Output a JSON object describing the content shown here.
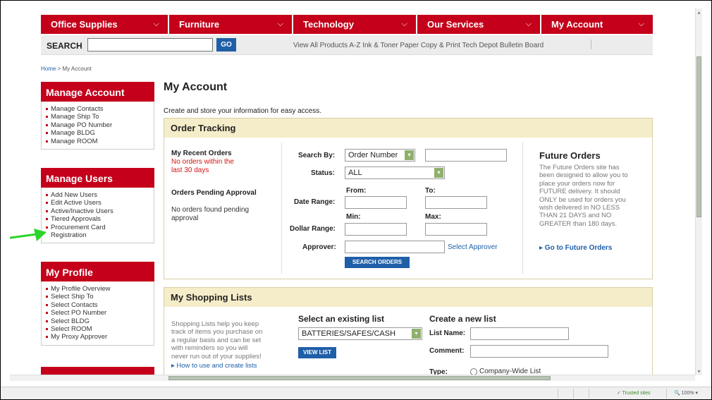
{
  "nav": {
    "items": [
      "Office Supplies",
      "Furniture",
      "Technology",
      "Our Services",
      "My Account"
    ],
    "chevron": "⌵"
  },
  "search": {
    "label": "SEARCH",
    "go": "GO",
    "quick_links": "View All Products A-Z Ink & Toner Paper Copy & Print Tech Depot Bulletin Board"
  },
  "breadcrumb": {
    "home": "Home",
    "sep": " > ",
    "current": "My Account"
  },
  "sidebar": {
    "manage_account": {
      "title": "Manage Account",
      "items": [
        "Manage Contacts",
        "Manage Ship To",
        "Manage PO Number",
        "Manage BLDG",
        "Manage ROOM"
      ]
    },
    "manage_users": {
      "title": "Manage Users",
      "items": [
        "Add New Users",
        "Edit Active Users",
        "Active/Inactive Users",
        "Tiered Approvals",
        "Procurement Card",
        "Registration"
      ]
    },
    "my_profile": {
      "title": "My Profile",
      "items": [
        "My Profile Overview",
        "Select Ship To",
        "Select Contacts",
        "Select PO Number",
        "Select BLDG",
        "Select ROOM",
        "My Proxy Approver"
      ]
    }
  },
  "main": {
    "title": "My Account",
    "intro": "Create and store your information for easy access.",
    "order_tracking": {
      "title": "Order Tracking",
      "recent_orders": "My Recent Orders",
      "recent_orders_note_1": "No orders within the",
      "recent_orders_note_2": "last 30 days",
      "pending": "Orders Pending Approval",
      "pending_note_1": "No orders found pending",
      "pending_note_2": "approval",
      "search_by": "Search By:",
      "search_by_value": "Order Number",
      "status": "Status:",
      "status_value": "ALL",
      "from": "From:",
      "to": "To:",
      "date_range": "Date Range:",
      "min": "Min:",
      "max": "Max:",
      "dollar_range": "Dollar Range:",
      "approver": "Approver:",
      "select_approver": "Select Approver",
      "search_orders": "SEARCH ORDERS"
    },
    "future_orders": {
      "title": "Future Orders",
      "lines": [
        "The Future Orders site has",
        "been designed to allow you to",
        "place your orders now for",
        "FUTURE delivery. It should",
        "ONLY be used for orders you",
        "wish delivered in NO LESS",
        "THAN 21 DAYS and NO",
        "GREATER than 180 days."
      ],
      "link": "▸ Go to Future Orders"
    },
    "shopping_lists": {
      "title": "My Shopping Lists",
      "desc_lines": [
        "Shopping Lists help you keep",
        "track of items you purchase on",
        "a regular basis and can be set",
        "with reminders so you will",
        "never run out of your supplies!"
      ],
      "how_to": "▸ How to use and create lists",
      "select_existing": "Select an existing list",
      "existing_value": "BATTERIES/SAFES/CASH",
      "view_list": "VIEW LIST",
      "create_new": "Create a new list",
      "list_name": "List Name:",
      "comment": "Comment:",
      "type": "Type:",
      "company_wide": "Company-Wide List"
    }
  },
  "statusbar": {
    "trusted": "✓ Trusted sites",
    "zoom": "🔍 100%  ▾"
  },
  "colors": {
    "brand_red": "#c4001a",
    "link_blue": "#1f5fa8",
    "panel_header": "#f5edc9",
    "arrow_green": "#2bd42b"
  }
}
